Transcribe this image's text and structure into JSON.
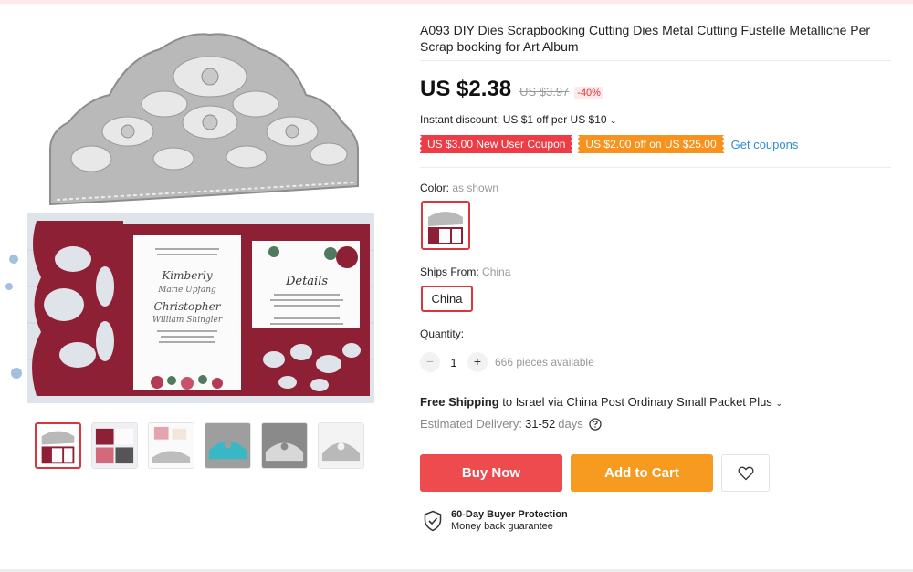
{
  "product": {
    "title": "A093 DIY Dies Scrapbooking Cutting Dies Metal Cutting Fustelle Metalliche Per Scrap booking for Art Album"
  },
  "pricing": {
    "price": "US $2.38",
    "original_price": "US $3.97",
    "discount": "-40%",
    "instant_discount": "Instant discount: US $1 off per US $10"
  },
  "coupons": {
    "items": [
      {
        "label": "US $3.00 New User Coupon",
        "color": "#ee3c46"
      },
      {
        "label": "US $2.00 off on US $25.00",
        "color": "#f6921e"
      }
    ],
    "get_label": "Get coupons"
  },
  "options": {
    "color_label": "Color:",
    "color_value": "as shown",
    "ships_from_label": "Ships From:",
    "ships_from_value": "China",
    "ships_option": "China"
  },
  "quantity": {
    "label": "Quantity:",
    "value": "1",
    "minus": "−",
    "plus": "+",
    "available": "666 pieces available"
  },
  "shipping": {
    "free_label": "Free Shipping",
    "details": "to Israel via China Post Ordinary Small Packet Plus",
    "estimated_label": "Estimated Delivery:",
    "estimated_value": "31-52",
    "estimated_unit": "days"
  },
  "actions": {
    "buy_now": "Buy Now",
    "add_to_cart": "Add to Cart"
  },
  "protection": {
    "title": "60-Day Buyer Protection",
    "subtitle": "Money back guarantee"
  },
  "colors": {
    "accent_red": "#ee4b4f",
    "accent_orange": "#f69b1f",
    "link_blue": "#2e8ed2"
  }
}
